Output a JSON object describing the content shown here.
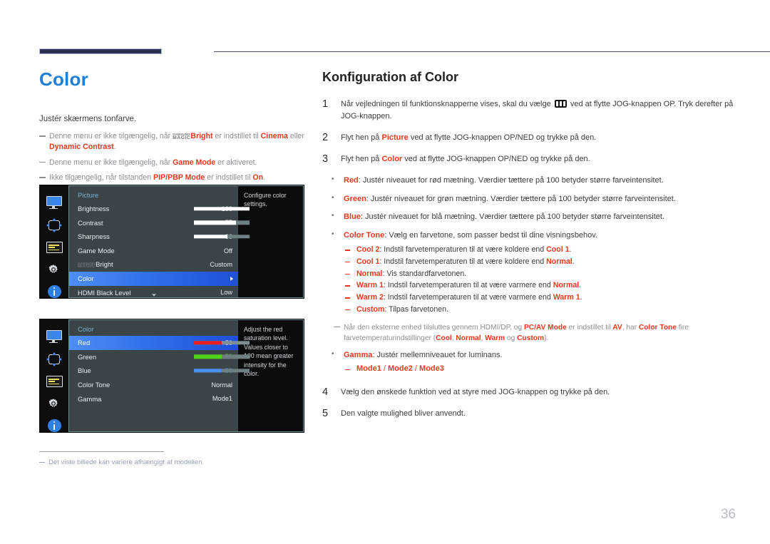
{
  "page": {
    "title": "Color",
    "number": "36"
  },
  "left": {
    "intro": "Justér skærmens tonfarve.",
    "notes": [
      {
        "pre": "Denne menu er ikke tilgængelig, når ",
        "magic_top": "SAMSUNG",
        "magic_bottom": "MAGIC",
        "bold1": "Bright",
        "mid": " er indstillet til ",
        "bold2": "Cinema",
        "post": " eller",
        "line2_bold": "Dynamic Contrast",
        "line2_post": "."
      },
      {
        "pre": "Denne menu er ikke tilgængelig, når ",
        "bold1": "Game Mode",
        "post": " er aktiveret."
      },
      {
        "pre": "Ikke tilgængelig, når tilstanden ",
        "bold1": "PIP/PBP Mode",
        "mid": " er indstillet til ",
        "bold2": "On",
        "post": "."
      }
    ],
    "footnote": "Det viste billede kan variere afhængigt af modellen."
  },
  "osd1": {
    "title": "Picture",
    "help": "Configure color settings.",
    "sidebar_icons": [
      "monitor-icon",
      "four-way-arrows-icon",
      "osd-list-icon",
      "gear-icon",
      "info-icon"
    ],
    "rows": [
      {
        "label": "Brightness",
        "value": "100",
        "bar": 100,
        "type": "slider"
      },
      {
        "label": "Contrast",
        "value": "75",
        "bar": 75,
        "type": "slider"
      },
      {
        "label": "Sharpness",
        "value": "60",
        "bar": 60,
        "type": "slider"
      },
      {
        "label": "Game Mode",
        "value": "Off",
        "type": "value"
      },
      {
        "label": "MAGICBright",
        "magic_top": "SAMSUNG",
        "magic_bottom": "MAGIC",
        "magic_suffix": "Bright",
        "value": "Custom",
        "type": "magic"
      },
      {
        "label": "Color",
        "value": "",
        "type": "selected"
      },
      {
        "label": "HDMI Black Level",
        "value": "Low",
        "type": "value"
      }
    ]
  },
  "osd2": {
    "title": "Color",
    "help": "Adjust the red saturation level. Values closer to 100 mean greater intensity for the color.",
    "sidebar_icons": [
      "monitor-icon",
      "four-way-arrows-icon",
      "osd-list-icon",
      "gear-icon",
      "info-icon"
    ],
    "rows": [
      {
        "label": "Red",
        "value": "50",
        "bar": 50,
        "type": "slider-selected",
        "color": "red"
      },
      {
        "label": "Green",
        "value": "50",
        "bar": 50,
        "type": "slider",
        "color": "green"
      },
      {
        "label": "Blue",
        "value": "50",
        "bar": 50,
        "type": "slider",
        "color": "blue"
      },
      {
        "label": "Color Tone",
        "value": "Normal",
        "type": "value"
      },
      {
        "label": "Gamma",
        "value": "Mode1",
        "type": "value"
      }
    ]
  },
  "right": {
    "heading": "Konfiguration af Color",
    "steps": [
      {
        "num": "1",
        "pre": "Når vejledningen til funktionsknapperne vises, skal du vælge ",
        "icon": "jog-menu-icon",
        "post": " ved at flytte JOG-knappen OP. Tryk derefter på JOG-knappen."
      },
      {
        "num": "2",
        "pre": "Flyt hen på ",
        "bold": "Picture",
        "post": " ved at flytte JOG-knappen OP/NED og trykke på den."
      },
      {
        "num": "3",
        "pre": "Flyt hen på ",
        "bold": "Color",
        "post": " ved at flytte JOG-knappen OP/NED og trykke på den."
      }
    ],
    "bullets": [
      {
        "bold": "Red",
        "text": ": Justér niveauet for rød mætning. Værdier tættere på 100 betyder større farveintensitet."
      },
      {
        "bold": "Green",
        "text": ": Justér niveauet for grøn mætning. Værdier tættere på 100 betyder større farveintensitet."
      },
      {
        "bold": "Blue",
        "text": ": Justér niveauet for blå mætning. Værdier tættere på 100 betyder større farveintensitet."
      },
      {
        "bold": "Color Tone",
        "text": ": Vælg en farvetone, som passer bedst til dine visningsbehov."
      }
    ],
    "subbullets": [
      {
        "bold": "Cool 2",
        "mid": ": Indstil farvetemperaturen til at være koldere end ",
        "bold2": "Cool 1",
        "post": "."
      },
      {
        "bold": "Cool 1",
        "mid": ": Indstil farvetemperaturen til at være koldere end ",
        "bold2": "Normal",
        "post": "."
      },
      {
        "bold": "Normal",
        "mid": ": Vis standardfarvetonen.",
        "bold2": "",
        "post": ""
      },
      {
        "bold": "Warm 1",
        "mid": ": Indstil farvetemperaturen til at være varmere end ",
        "bold2": "Normal",
        "post": "."
      },
      {
        "bold": "Warm 2",
        "mid": ": Indstil farvetemperaturen til at være varmere end ",
        "bold2": "Warm 1",
        "post": "."
      },
      {
        "bold": "Custom",
        "mid": ": Tilpas farvetonen.",
        "bold2": "",
        "post": ""
      }
    ],
    "av_note": {
      "p1": "Når den eksterne enhed tilsluttes gennem HDMI/DP, og ",
      "b1": "PC/AV Mode",
      "p2": " er indstillet til ",
      "b2": "AV",
      "p3": ", har ",
      "b3": "Color Tone",
      "p4": " fire farvetemperaturindstillinger (",
      "b4": "Cool",
      "p5": ", ",
      "b5": "Normal",
      "p6": ", ",
      "b6": "Warm",
      "p7": " og ",
      "b7": "Custom",
      "p8": ")."
    },
    "gamma_bullet": {
      "bold": "Gamma",
      "text": ": Justér mellemniveauet for luminans."
    },
    "gamma_modes": {
      "m1": "Mode1",
      "sep1": " / ",
      "m2": "Mode2",
      "sep2": " / ",
      "m3": "Mode3"
    },
    "steps_tail": [
      {
        "num": "4",
        "text": "Vælg den ønskede funktion ved at styre med JOG-knappen og trykke på den."
      },
      {
        "num": "5",
        "text": "Den valgte mulighed bliver anvendt."
      }
    ]
  }
}
